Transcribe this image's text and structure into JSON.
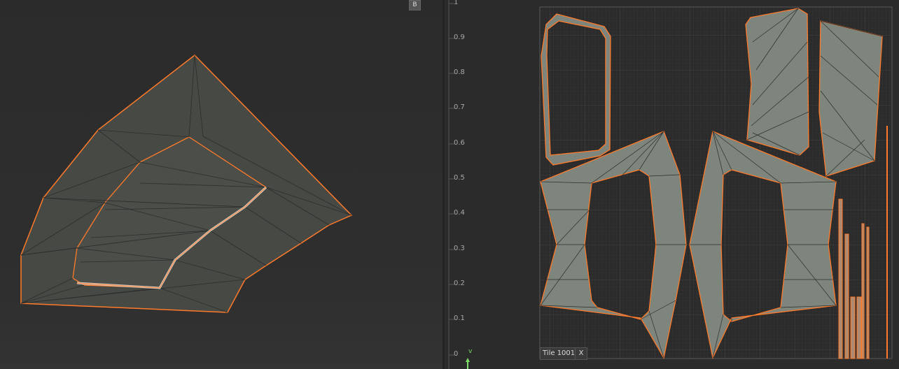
{
  "viewport": {
    "badge": "B"
  },
  "uv_editor": {
    "ruler_ticks": [
      "1",
      "0.9",
      "0.8",
      "0.7",
      "0.6",
      "0.5",
      "0.4",
      "0.3",
      "0.2",
      "0.1",
      "0"
    ],
    "axis_label": "v",
    "tile_label": "Tile 1001",
    "close_label": "X"
  },
  "colors": {
    "edge_highlight": "#ff7a2a",
    "mesh_face_3d": "#474a44",
    "uv_face": "#7e857c",
    "wire": "#2c2e2c"
  }
}
